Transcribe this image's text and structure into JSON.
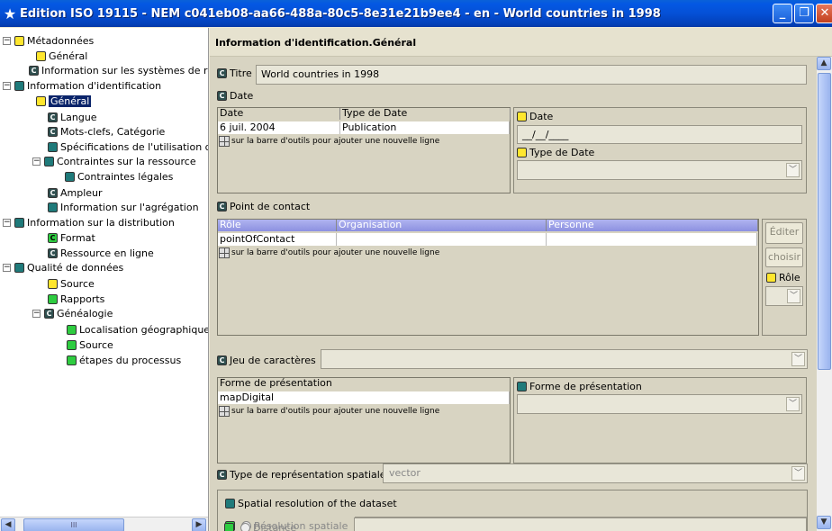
{
  "window": {
    "title": "Edition ISO 19115 - NEM c041eb08-aa66-488a-80c5-8e31e21b9ee4 - en - World countries in 1998",
    "title_color": "#0454e0"
  },
  "tree": {
    "items": [
      {
        "label": "Métadonnées"
      },
      {
        "label": "Général"
      },
      {
        "label": "Information sur les systèmes de ré"
      },
      {
        "label": "Information d'identification"
      },
      {
        "label": "Général"
      },
      {
        "label": "Langue"
      },
      {
        "label": "Mots-clefs, Catégorie"
      },
      {
        "label": "Spécifications de l'utilisation de"
      },
      {
        "label": "Contraintes sur la ressource"
      },
      {
        "label": "Contraintes légales"
      },
      {
        "label": "Ampleur"
      },
      {
        "label": "Information sur l'agrégation"
      },
      {
        "label": "Information sur la distribution"
      },
      {
        "label": "Format"
      },
      {
        "label": "Ressource en ligne"
      },
      {
        "label": "Qualité de données"
      },
      {
        "label": "Source"
      },
      {
        "label": "Rapports"
      },
      {
        "label": "Généalogie"
      },
      {
        "label": "Localisation géographique"
      },
      {
        "label": "Source"
      },
      {
        "label": "étapes du processus"
      }
    ],
    "scroll_thumb": "III"
  },
  "main": {
    "header": "Information d'identification.Général",
    "titre_label": "Titre",
    "titre_value": "World countries in 1998",
    "date_section": "Date",
    "date_table": {
      "headers": [
        "Date",
        "Type de Date"
      ],
      "rows": [
        [
          "6 juil. 2004",
          "Publication"
        ]
      ],
      "add_hint": "sur la barre d'outils pour ajouter une nouvelle ligne"
    },
    "date_editor": {
      "date_label": "Date",
      "date_value": "__/__/____",
      "type_label": "Type de Date"
    },
    "contact_section": "Point de contact",
    "contact_table": {
      "headers": [
        "Rôle",
        "Organisation",
        "Personne"
      ],
      "rows": [
        [
          "pointOfContact",
          "",
          ""
        ]
      ],
      "add_hint": "sur la barre d'outils pour ajouter une nouvelle ligne"
    },
    "contact_buttons": {
      "edit": "Éditer",
      "choose": "choisir",
      "role_label": "Rôle"
    },
    "charset_label": "Jeu de caractères",
    "presentation_table": {
      "headers": [
        "Forme de présentation"
      ],
      "rows": [
        [
          "mapDigital"
        ]
      ],
      "add_hint": "sur la barre d'outils pour ajouter une nouvelle ligne"
    },
    "presentation_editor_label": "Forme de présentation",
    "spatial_type_label": "Type de représentation spatiale",
    "spatial_type_value": "vector",
    "spatial_resolution": {
      "title": "Spatial resolution of the dataset",
      "option1": "Résolution spatiale",
      "option2": "Distance"
    }
  },
  "icons": [
    "star-icon",
    "minimize-icon",
    "maximize-icon",
    "close-icon",
    "expand-icon",
    "collapse-icon",
    "add-row-icon",
    "dropdown-arrow-icon",
    "scroll-up-icon",
    "scroll-down-icon",
    "scroll-left-icon",
    "scroll-right-icon"
  ],
  "colors": {
    "selection": "#0a246a",
    "mandatory": "#ffe62e",
    "optional": "#2ecc40",
    "conditional": "#1f7a7a"
  }
}
